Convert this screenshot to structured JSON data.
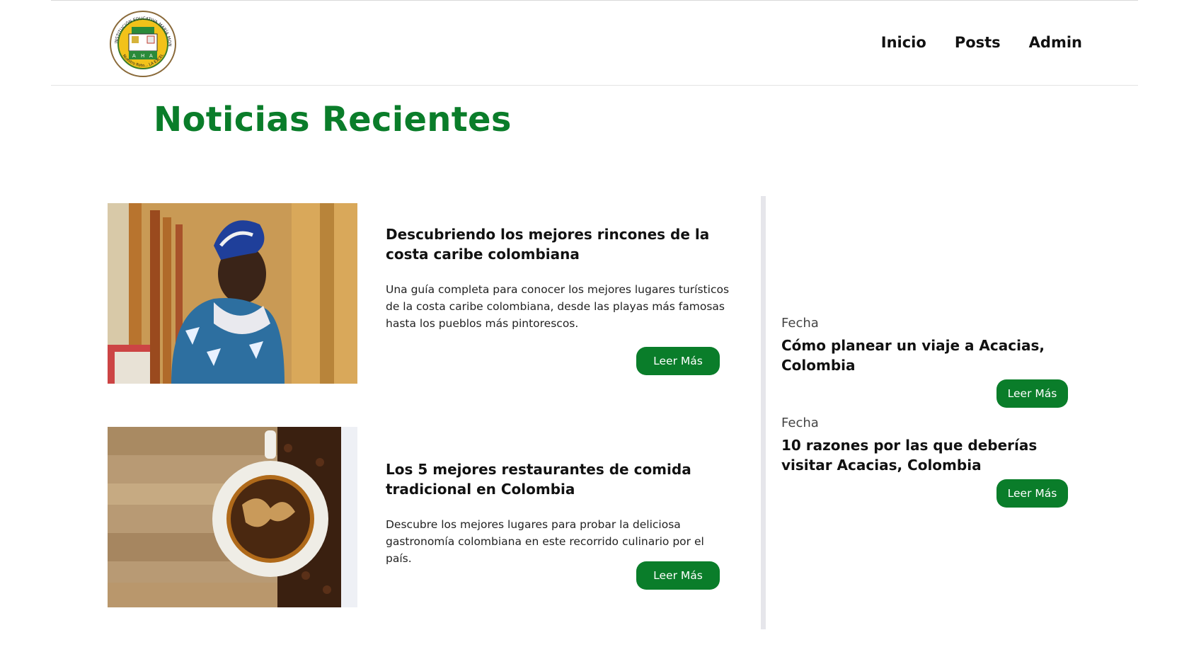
{
  "header": {
    "logo_text_top": "INSTITUCIÓN EDUCATIVA MARÍA MONTESSORI",
    "logo_text_bottom": "Nuestro Reto... LA EXCELENCIA",
    "nav": [
      "Inicio",
      "Posts",
      "Admin"
    ]
  },
  "main": {
    "title": "Noticias Recientes",
    "articles": [
      {
        "title": "Descubriendo los mejores rincones de la costa caribe colombiana",
        "summary": "Una guía completa para conocer los mejores lugares turísticos de la costa caribe colombiana, desde las playas más famosas hasta los pueblos más pintorescos.",
        "button": "Leer Más",
        "image_icon": "woman-portrait-image"
      },
      {
        "title": "Los 5 mejores restaurantes de comida tradicional en Colombia",
        "summary": "Descubre los mejores lugares para probar la deliciosa gastronomía colombiana en este recorrido culinario por el país.",
        "button": "Leer Más",
        "image_icon": "coffee-cup-image"
      }
    ]
  },
  "sidebar": {
    "items": [
      {
        "date": "Fecha",
        "title": "Cómo planear un viaje a Acacias, Colombia",
        "button": "Leer Más"
      },
      {
        "date": "Fecha",
        "title": "10 razones por las que deberías visitar Acacias, Colombia",
        "button": "Leer Más"
      }
    ]
  },
  "colors": {
    "accent": "#0a7d2a",
    "divider": "#e6e6eb"
  }
}
